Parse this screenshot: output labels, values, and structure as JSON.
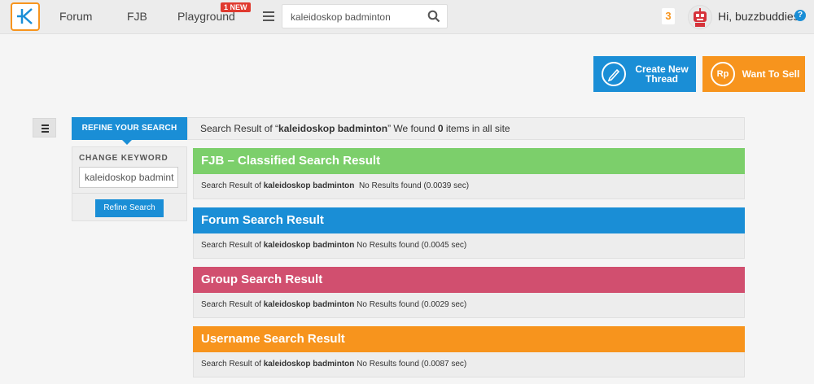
{
  "header": {
    "nav": [
      "Forum",
      "FJB",
      "Playground"
    ],
    "new_badge": "1 NEW",
    "search_value": "kaleidoskop badminton",
    "notifications": "3",
    "greeting": "Hi, buzzbuddies",
    "help": "?"
  },
  "actions": {
    "create_thread": "Create New Thread",
    "want_to_sell": "Want To Sell",
    "sell_icon_text": "Rp"
  },
  "sidebar": {
    "tab_label": "REFINE YOUR SEARCH",
    "change_keyword_label": "CHANGE KEYWORD",
    "keyword_value": "kaleidoskop badmint",
    "refine_button": "Refine Search"
  },
  "summary": {
    "prefix": "Search Result of “",
    "keyword": "kaleidoskop badminton",
    "middle": "” We found ",
    "count": "0",
    "suffix": " items in all site"
  },
  "results": [
    {
      "title": "FJB – Classified Search Result",
      "color": "#7ccf6b",
      "prefix": "Search Result of ",
      "keyword": "kaleidoskop badminton",
      "status": "  No Results found (0.0039 sec)"
    },
    {
      "title": "Forum Search Result",
      "color": "#1a8ed6",
      "prefix": "Search Result of ",
      "keyword": "kaleidoskop badminton",
      "status": " No Results found (0.0045 sec)"
    },
    {
      "title": "Group Search Result",
      "color": "#d14f6f",
      "prefix": "Search Result of ",
      "keyword": "kaleidoskop badminton",
      "status": " No Results found (0.0029 sec)"
    },
    {
      "title": "Username Search Result",
      "color": "#f7941d",
      "prefix": "Search Result of ",
      "keyword": "kaleidoskop badminton",
      "status": " No Results found (0.0087 sec)"
    }
  ]
}
